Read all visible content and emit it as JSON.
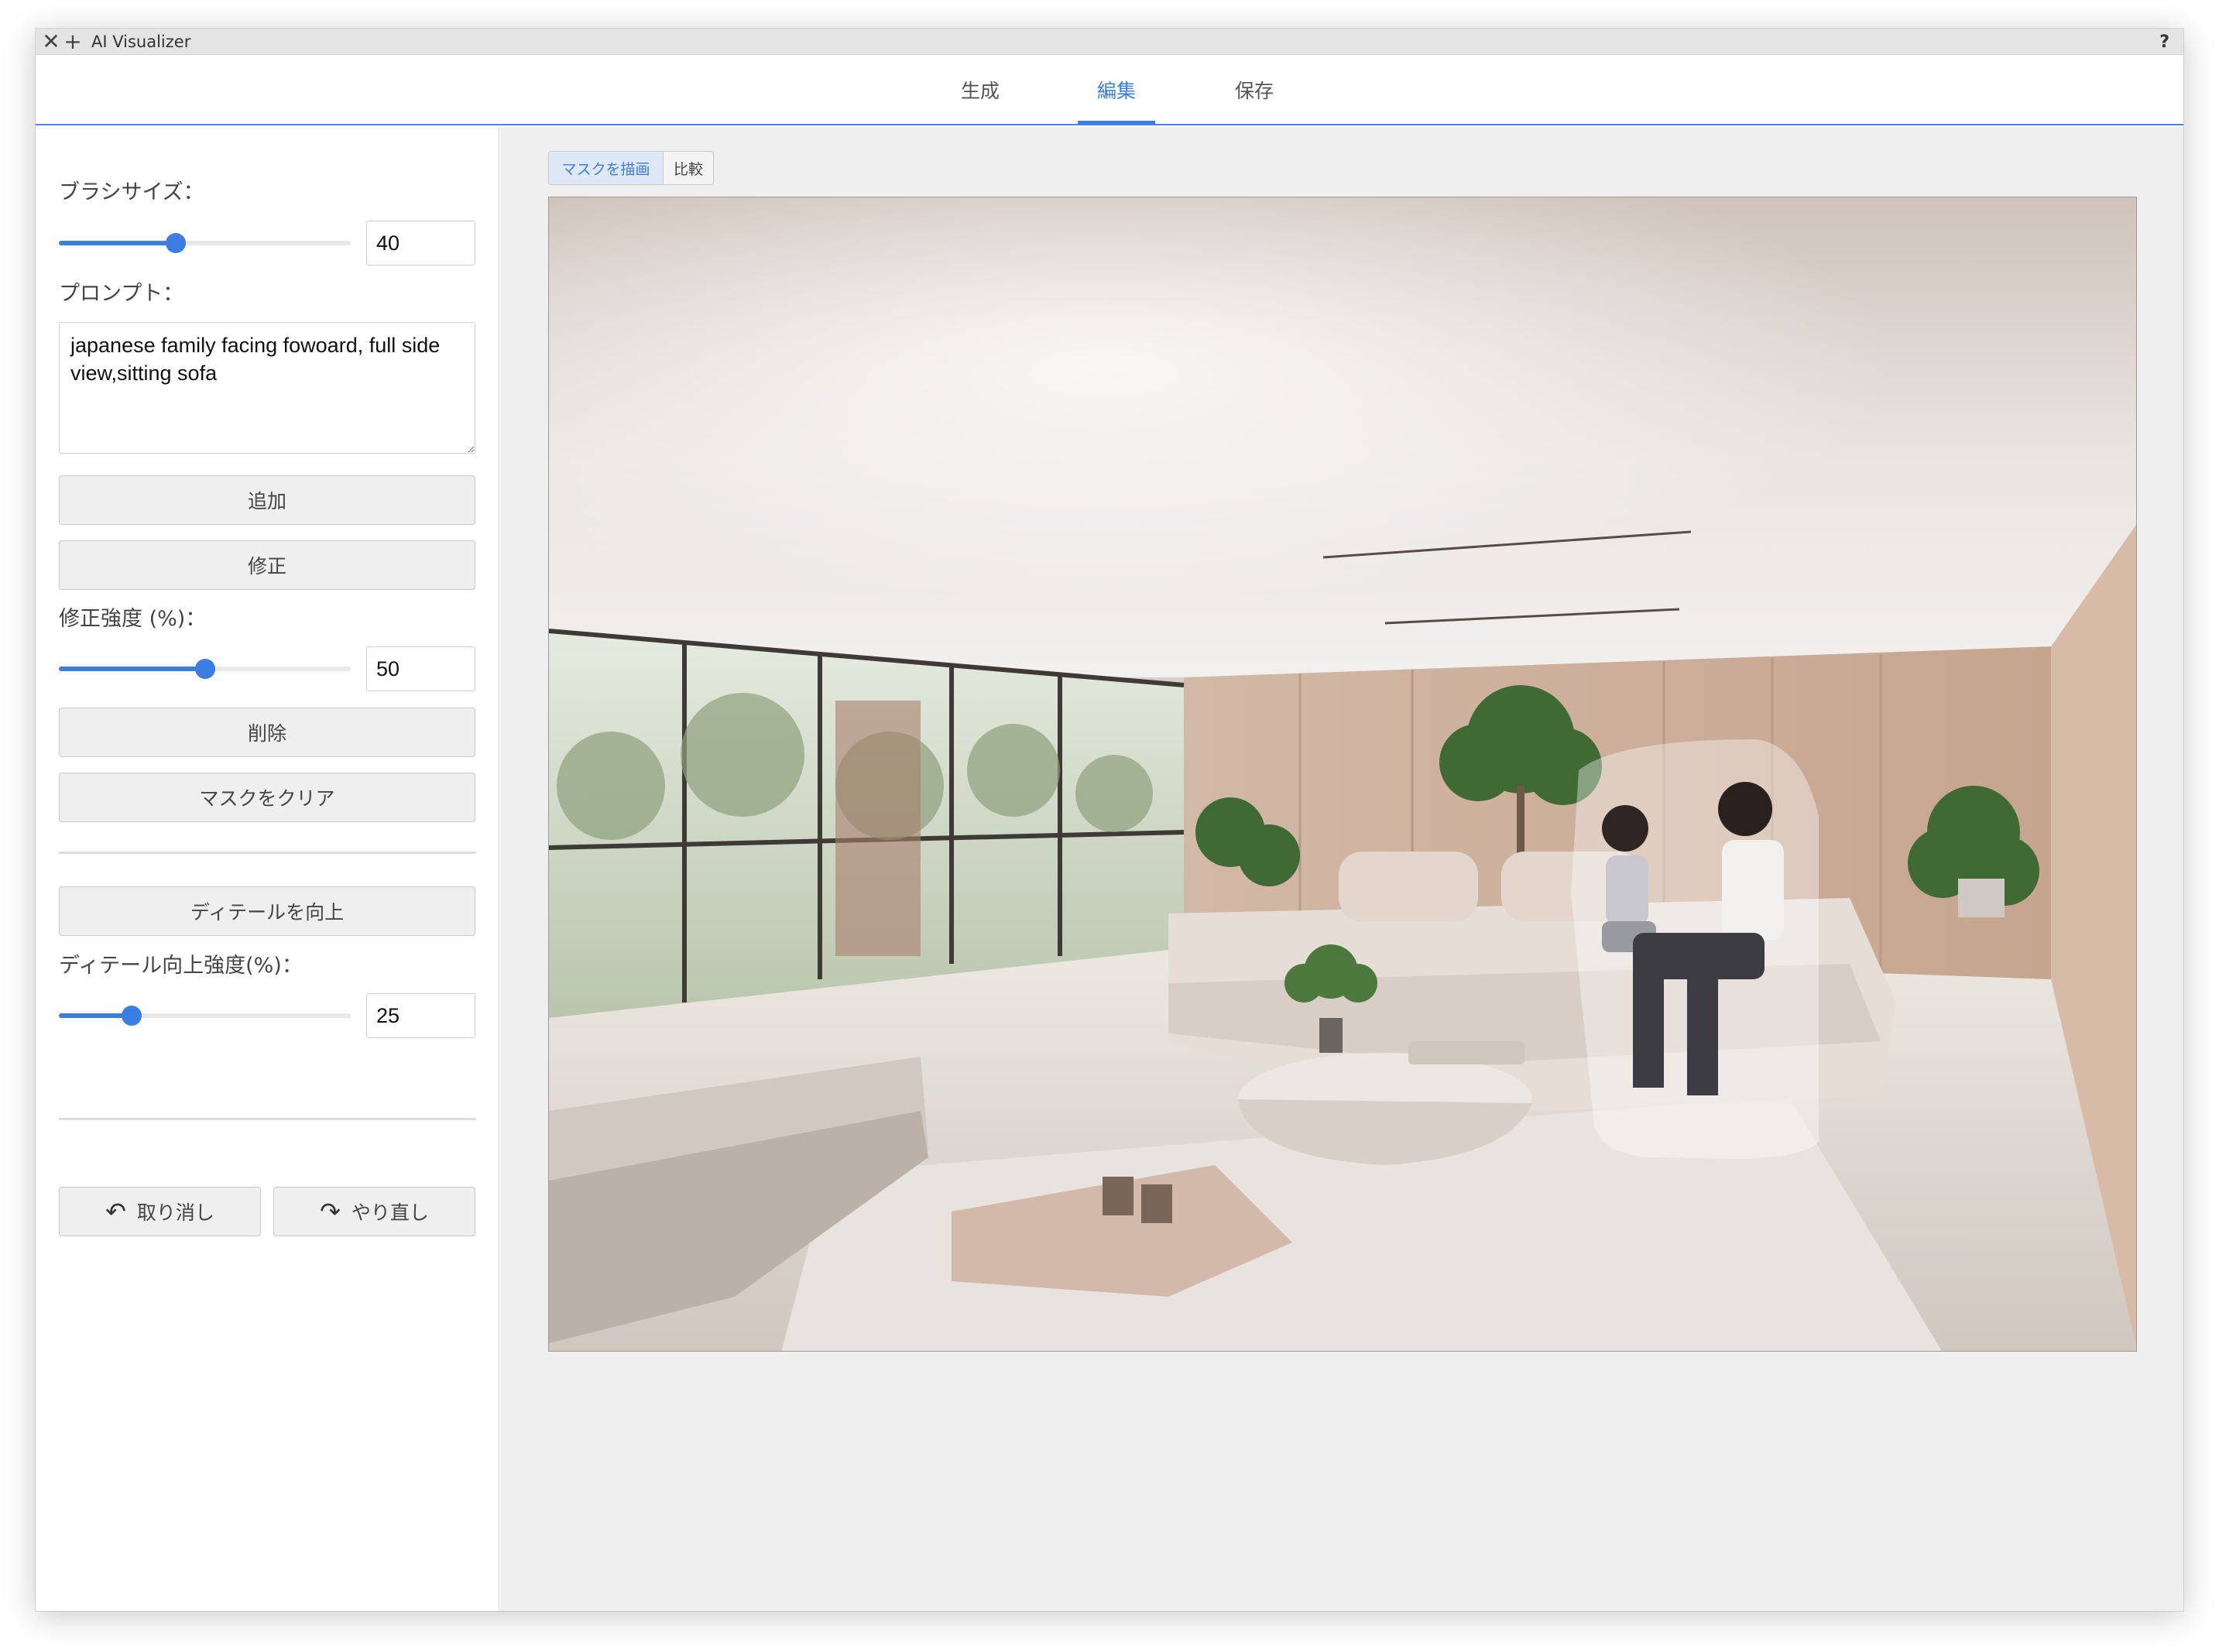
{
  "window": {
    "title": "AI Visualizer",
    "help": "?"
  },
  "tabs": [
    {
      "label": "生成"
    },
    {
      "label": "編集"
    },
    {
      "label": "保存"
    }
  ],
  "sidebar": {
    "brush_size_label": "ブラシサイズ：",
    "brush_size_value": "40",
    "brush_size_fraction": 0.4,
    "prompt_label": "プロンプト：",
    "prompt_value": "japanese family facing fowoard, full side view,sitting sofa",
    "add_label": "追加",
    "modify_label": "修正",
    "strength_label": "修正強度 (%)：",
    "strength_value": "50",
    "strength_fraction": 0.5,
    "delete_label": "削除",
    "clear_mask_label": "マスクをクリア",
    "enhance_label": "ディテールを向上",
    "enhance_strength_label": "ディテール向上強度(%)：",
    "enhance_strength_value": "25",
    "enhance_fraction": 0.25,
    "undo_label": "取り消し",
    "redo_label": "やり直し"
  },
  "canvas": {
    "draw_mask_label": "マスクを描画",
    "compare_label": "比較"
  },
  "icons": {
    "close": "close-icon",
    "add": "plus-icon",
    "undo": "undo-icon",
    "redo": "redo-icon"
  },
  "colors": {
    "accent": "#3b7de0"
  }
}
